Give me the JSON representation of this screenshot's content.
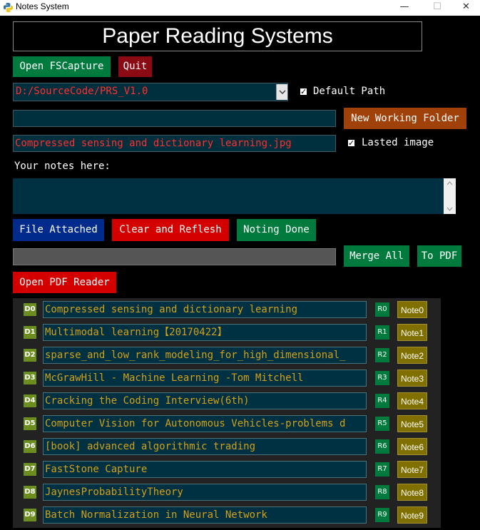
{
  "window": {
    "title": "Notes System",
    "minimize": "—",
    "maximize": "☐",
    "close": "✕"
  },
  "header": {
    "title": "Paper Reading Systems"
  },
  "buttons": {
    "open_fscapture": "Open FSCapture",
    "quit": "Quit",
    "new_working_folder": "New Working Folder",
    "file_attached": "File Attached",
    "clear_and_reflesh": "Clear and Reflesh",
    "noting_done": "Noting Done",
    "merge_all": "Merge All",
    "to_pdf": "To PDF",
    "open_pdf_reader": "Open PDF Reader"
  },
  "path_select": {
    "value": "D:/SourceCode/PRS_V1.0"
  },
  "default_path": {
    "label": "Default Path",
    "checked": true,
    "mark": "✓"
  },
  "working_folder_entry": {
    "value": ""
  },
  "image_entry": {
    "value": "Compressed sensing and dictionary learning.jpg"
  },
  "lasted_image": {
    "label": "Lasted image",
    "checked": true,
    "mark": "✓"
  },
  "notes_label": "Your notes here:",
  "notes_text": "",
  "merge_entry": {
    "value": ""
  },
  "docs": [
    {
      "d": "D0",
      "title": "Compressed sensing and dictionary learning",
      "r": "R0",
      "note": "Note0"
    },
    {
      "d": "D1",
      "title": "Multimodal learning【20170422】",
      "r": "R1",
      "note": "Note1"
    },
    {
      "d": "D2",
      "title": "sparse_and_low_rank_modeling_for_high_dimensional_",
      "r": "R2",
      "note": "Note2"
    },
    {
      "d": "D3",
      "title": "McGrawHill - Machine Learning -Tom Mitchell",
      "r": "R3",
      "note": "Note3"
    },
    {
      "d": "D4",
      "title": "Cracking the Coding Interview(6th)",
      "r": "R4",
      "note": "Note4"
    },
    {
      "d": "D5",
      "title": "Computer Vision for Autonomous Vehicles-problems d",
      "r": "R5",
      "note": "Note5"
    },
    {
      "d": "D6",
      "title": "[book] advanced algorithmic trading",
      "r": "R6",
      "note": "Note6"
    },
    {
      "d": "D7",
      "title": "FastStone Capture",
      "r": "R7",
      "note": "Note7"
    },
    {
      "d": "D8",
      "title": "JaynesProbabilityTheory",
      "r": "R8",
      "note": "Note8"
    },
    {
      "d": "D9",
      "title": "Batch Normalization in Neural Network",
      "r": "R9",
      "note": "Note9"
    }
  ]
}
